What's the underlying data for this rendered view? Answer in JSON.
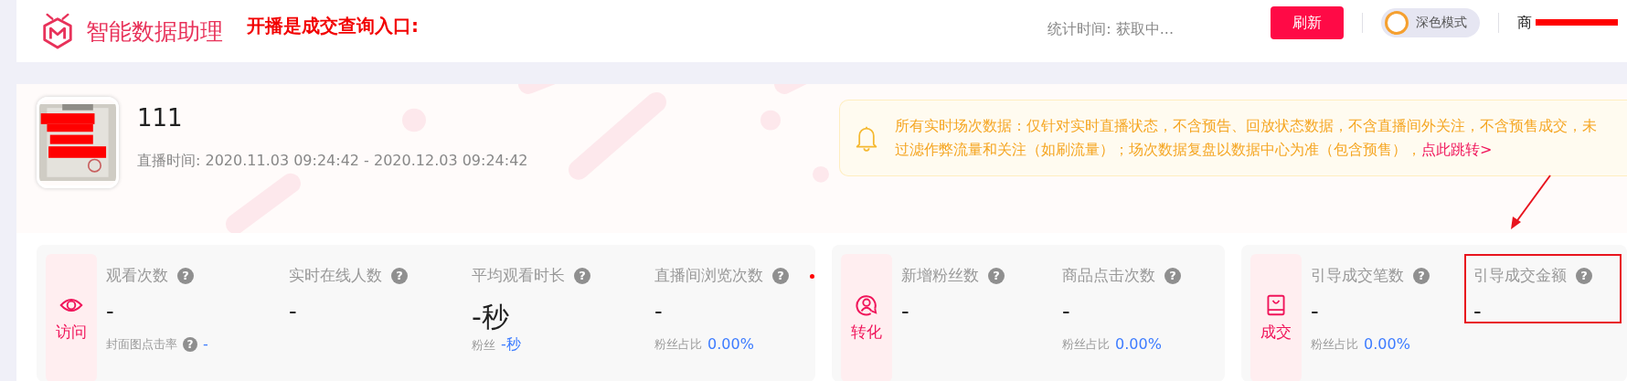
{
  "header": {
    "app_title": "智能数据助理",
    "entry_note": "开播是成交查询入口:",
    "stats_time": "统计时间: 获取中...",
    "refresh_button": "刷新",
    "dark_mode": {
      "label": "深色模式",
      "on": false
    },
    "account": "商",
    "account_redacted": true
  },
  "live": {
    "title": "111",
    "time": "直播时间: 2020.11.03 09:24:42 - 2020.12.03 09:24:42",
    "notice": {
      "text": "所有实时场次数据：仅针对实时直播状态，不含预告、回放状态数据，不含直播间外关注，不含预售成交，未过滤作弊流量和关注（如刷流量）；场次数据复盘以数据中心为准（包含预售），",
      "link": "点此跳转>"
    }
  },
  "groups": [
    {
      "kind": "eye",
      "label": "访问",
      "marked": true,
      "metrics": [
        {
          "label": "观看次数",
          "help": "?",
          "value": "-",
          "highlighted": false,
          "sub": {
            "label": "封面图点击率",
            "help": "?",
            "value": "-"
          }
        },
        {
          "label": "实时在线人数",
          "help": "?",
          "value": "-",
          "highlighted": false
        },
        {
          "label": "平均观看时长",
          "help": "?",
          "value": "-秒",
          "highlighted": false,
          "sub": {
            "label": "粉丝",
            "value": "-秒"
          }
        },
        {
          "label": "直播间浏览次数",
          "help": "?",
          "value": "-",
          "highlighted": false,
          "sub": {
            "label": "粉丝占比",
            "value": "0.00%"
          }
        }
      ]
    },
    {
      "kind": "person",
      "label": "转化",
      "marked": false,
      "metrics": [
        {
          "label": "新增粉丝数",
          "help": "?",
          "value": "-",
          "highlighted": false
        },
        {
          "label": "商品点击次数",
          "help": "?",
          "value": "-",
          "highlighted": false,
          "sub": {
            "label": "粉丝占比",
            "value": "0.00%"
          }
        }
      ]
    },
    {
      "kind": "bag",
      "label": "成交",
      "marked": false,
      "metrics": [
        {
          "label": "引导成交笔数",
          "help": "?",
          "value": "-",
          "highlighted": false,
          "sub": {
            "label": "粉丝占比",
            "value": "0.00%"
          }
        },
        {
          "label": "引导成交金额",
          "help": "?",
          "value": "-",
          "highlighted": true
        }
      ]
    }
  ]
}
